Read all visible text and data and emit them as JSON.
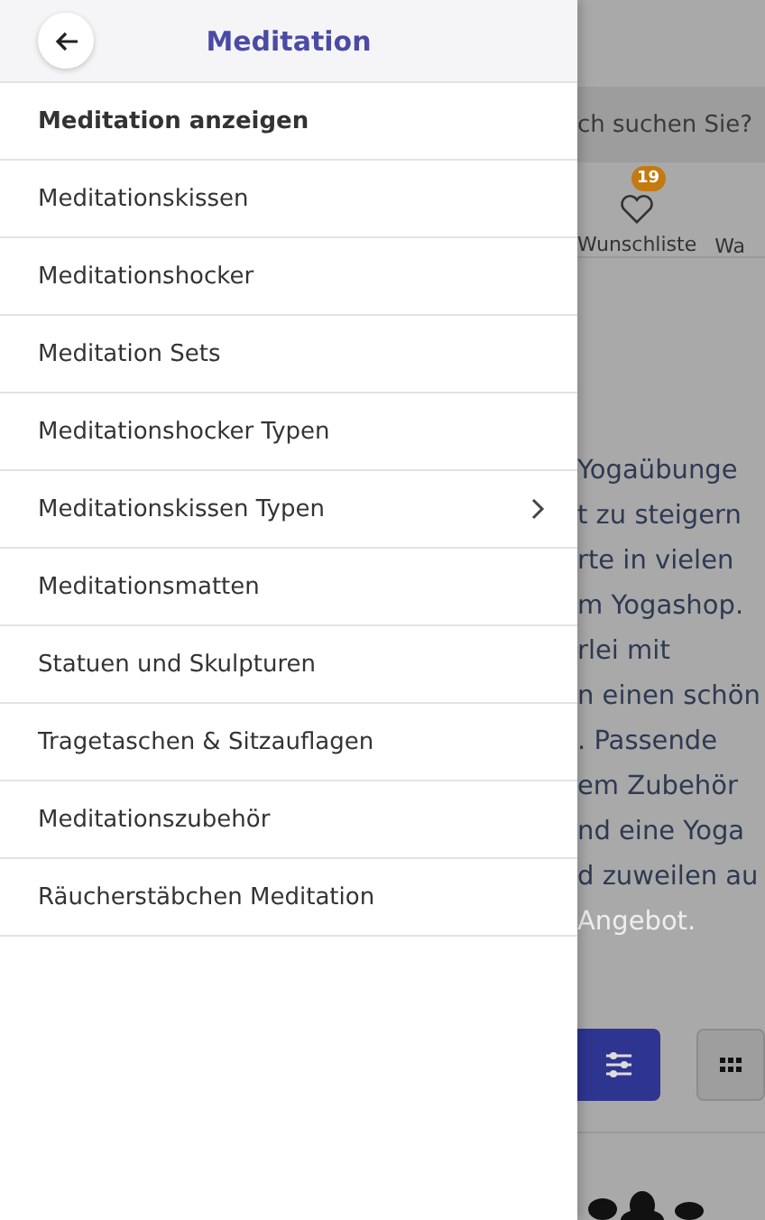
{
  "drawer": {
    "title": "Meditation",
    "items": [
      {
        "label": "Meditation anzeigen",
        "kind": "overview",
        "expandable": false
      },
      {
        "label": "Meditationskissen",
        "kind": "link",
        "expandable": false
      },
      {
        "label": "Meditationshocker",
        "kind": "link",
        "expandable": false
      },
      {
        "label": "Meditation Sets",
        "kind": "link",
        "expandable": false
      },
      {
        "label": "Meditationshocker Typen",
        "kind": "link",
        "expandable": false
      },
      {
        "label": "Meditationskissen Typen",
        "kind": "link",
        "expandable": true
      },
      {
        "label": "Meditationsmatten",
        "kind": "link",
        "expandable": false
      },
      {
        "label": "Statuen und Skulpturen",
        "kind": "link",
        "expandable": false
      },
      {
        "label": "Tragetaschen & Sitzauflagen",
        "kind": "link",
        "expandable": false
      },
      {
        "label": "Meditationszubehör",
        "kind": "link",
        "expandable": false
      },
      {
        "label": "Räucherstäbchen Meditation",
        "kind": "link",
        "expandable": false
      }
    ]
  },
  "background": {
    "search": {
      "placeholder": "ch suchen Sie?"
    },
    "nav": [
      {
        "label": "Wunschliste",
        "badge": "19"
      },
      {
        "label": "Wa"
      }
    ],
    "text_lines": [
      {
        "text": "Yogaübunge",
        "faded": false
      },
      {
        "text": "t zu steigern",
        "faded": false
      },
      {
        "text": "rte in vielen",
        "faded": false
      },
      {
        "text": "m Yogashop.",
        "faded": false
      },
      {
        "text": "rlei mit",
        "faded": false
      },
      {
        "text": "n einen schön",
        "faded": false
      },
      {
        "text": ". Passende",
        "faded": false
      },
      {
        "text": "em Zubehör",
        "faded": false
      },
      {
        "text": "nd eine Yoga",
        "faded": false
      },
      {
        "text": "d zuweilen au",
        "faded": false
      },
      {
        "text": "Angebot.",
        "faded": true
      }
    ]
  }
}
